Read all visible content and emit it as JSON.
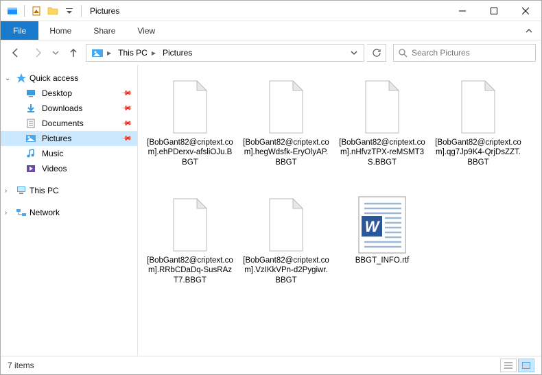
{
  "titlebar": {
    "title": "Pictures"
  },
  "ribbon": {
    "file_label": "File",
    "tabs": [
      "Home",
      "Share",
      "View"
    ]
  },
  "breadcrumb": {
    "segments": [
      "This PC",
      "Pictures"
    ]
  },
  "search": {
    "placeholder": "Search Pictures"
  },
  "sidebar": {
    "quick_access": {
      "label": "Quick access",
      "items": [
        {
          "label": "Desktop",
          "icon": "desktop",
          "pinned": true
        },
        {
          "label": "Downloads",
          "icon": "downloads",
          "pinned": true
        },
        {
          "label": "Documents",
          "icon": "documents",
          "pinned": true
        },
        {
          "label": "Pictures",
          "icon": "pictures",
          "pinned": true,
          "selected": true
        },
        {
          "label": "Music",
          "icon": "music",
          "pinned": false
        },
        {
          "label": "Videos",
          "icon": "videos",
          "pinned": false
        }
      ]
    },
    "this_pc": {
      "label": "This PC"
    },
    "network": {
      "label": "Network"
    }
  },
  "files": [
    {
      "name": "[BobGant82@criptext.com].ehPDerxv-afsliOJu.BBGT",
      "type": "blank"
    },
    {
      "name": "[BobGant82@criptext.com].hegWdsfk-EryOlyAP.BBGT",
      "type": "blank"
    },
    {
      "name": "[BobGant82@criptext.com].nHfvzTPX-reMSMT3S.BBGT",
      "type": "blank"
    },
    {
      "name": "[BobGant82@criptext.com].qg7Jp9K4-QrjDsZZT.BBGT",
      "type": "blank"
    },
    {
      "name": "[BobGant82@criptext.com].RRbCDaDq-SusRAzT7.BBGT",
      "type": "blank"
    },
    {
      "name": "[BobGant82@criptext.com].VzIKkVPn-d2Pygiwr.BBGT",
      "type": "blank"
    },
    {
      "name": "BBGT_INFO.rtf",
      "type": "rtf"
    }
  ],
  "statusbar": {
    "count_label": "7 items"
  }
}
